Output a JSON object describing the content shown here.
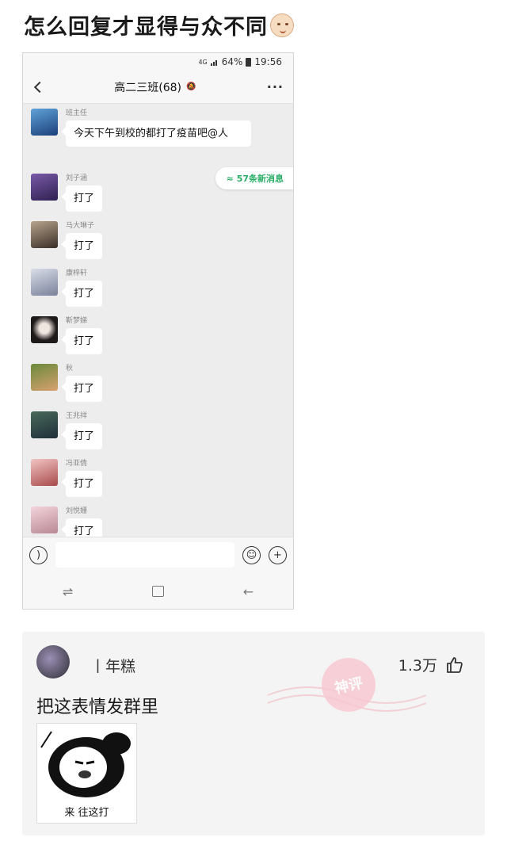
{
  "post": {
    "title": "怎么回复才显得与众不同"
  },
  "phone": {
    "status": {
      "network": "4G",
      "battery": "64%",
      "time": "19:56"
    },
    "chat_title": "高二三班(68)",
    "new_messages": "57条新消息",
    "messages": [
      {
        "sender": "班主任",
        "text": "今天下午到校的都打了疫苗吧@人",
        "avatar_color": "#3b5f9e"
      },
      {
        "sender": "刘子涵",
        "text": "打了",
        "avatar_color": "#5b3f7a"
      },
      {
        "sender": "马大琳子",
        "text": "打了",
        "avatar_color": "#6e5a4a"
      },
      {
        "sender": "康梓轩",
        "text": "打了",
        "avatar_color": "#9aa3b6"
      },
      {
        "sender": "靳梦娣",
        "text": "打了",
        "avatar_color": "#2f2a2a"
      },
      {
        "sender": "秋",
        "text": "打了",
        "avatar_color": "#7a6a3a"
      },
      {
        "sender": "王兆祥",
        "text": "打了",
        "avatar_color": "#3f5a6a"
      },
      {
        "sender": "冯亚倩",
        "text": "打了",
        "avatar_color": "#c98a8a"
      },
      {
        "sender": "刘悦姗",
        "text": "打了",
        "avatar_color": "#d8a8b0"
      }
    ]
  },
  "comment": {
    "username": "丨年糕",
    "likes": "1.3万",
    "text": "把这表情发群里",
    "stamp_text": "神评",
    "meme_caption": "来 往这打"
  }
}
